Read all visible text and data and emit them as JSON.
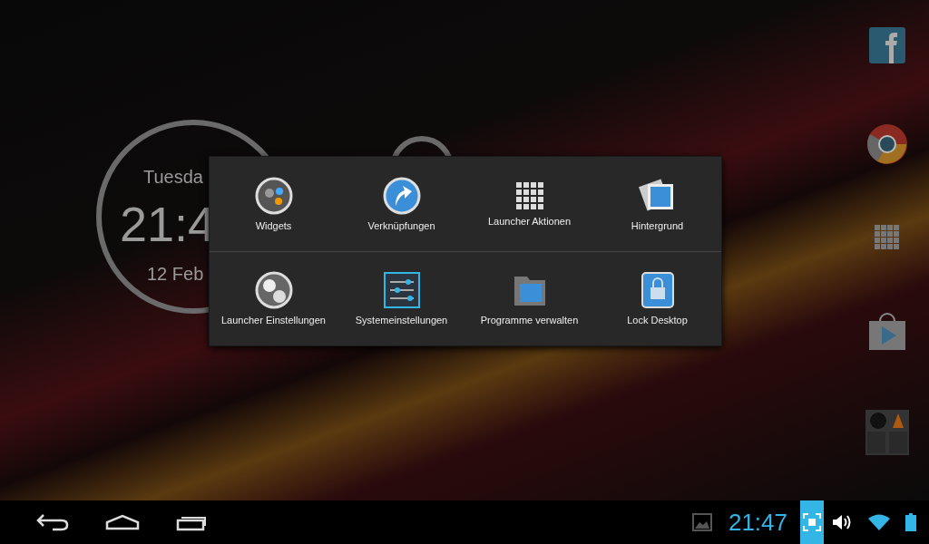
{
  "clock_widget": {
    "day": "Tuesda",
    "time": "21:4",
    "date": "12 Feb"
  },
  "menu": {
    "rows": [
      [
        {
          "label": "Widgets"
        },
        {
          "label": "Verknüpfungen"
        },
        {
          "label": "Launcher Aktionen"
        },
        {
          "label": "Hintergrund"
        }
      ],
      [
        {
          "label": "Launcher Einstellungen"
        },
        {
          "label": "Systemeinstellungen"
        },
        {
          "label": "Programme verwalten"
        },
        {
          "label": "Lock Desktop"
        }
      ]
    ]
  },
  "status_bar": {
    "time": "21:47",
    "screenshot_active": true
  }
}
